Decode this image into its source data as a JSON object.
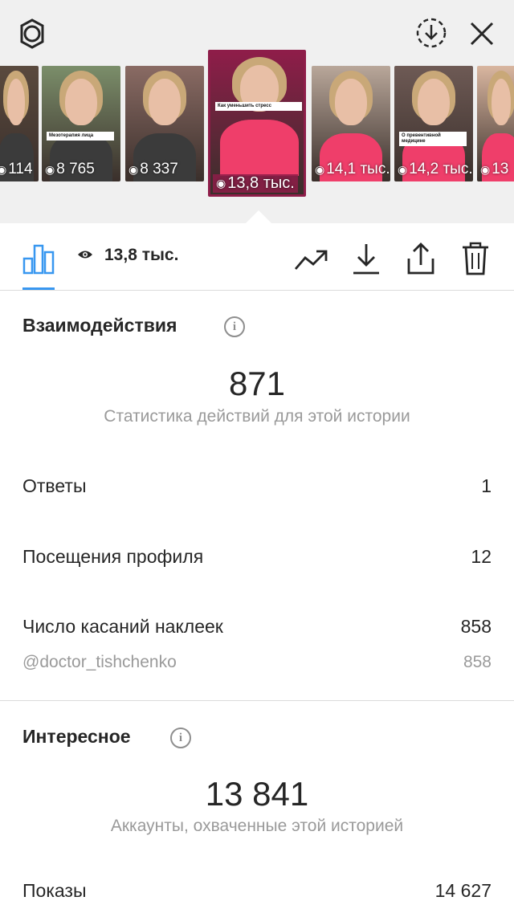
{
  "header": {
    "settings_icon": "gear-icon",
    "download_icon": "download-circle-icon",
    "close_icon": "close-icon"
  },
  "stories": [
    {
      "views": "114",
      "sticker": "",
      "bg": "#5a4a3e",
      "active": false
    },
    {
      "views": "8 765",
      "sticker": "Мезотерапия лица",
      "bg": "#7b8e6a",
      "active": false
    },
    {
      "views": "8 337",
      "sticker": "",
      "bg": "#8a6b64",
      "active": false
    },
    {
      "views": "13,8 тыс.",
      "sticker": "Как уменьшить стресс",
      "bg": "#8e1d49",
      "active": true
    },
    {
      "views": "14,1 тыс.",
      "sticker": "",
      "bg": "#b9a79a",
      "active": false
    },
    {
      "views": "14,2 тыс.",
      "sticker": "О превентивной медицине",
      "bg": "#6e5a55",
      "active": false
    },
    {
      "views": "13",
      "sticker": "",
      "bg": "#d9b6a0",
      "active": false
    }
  ],
  "toolbar": {
    "insights_tab_icon": "bar-chart-icon",
    "views_icon": "eye-icon",
    "views_label": "13,8 тыс.",
    "promote_icon": "trending-up-icon",
    "save_icon": "download-icon",
    "share_icon": "share-icon",
    "delete_icon": "trash-icon",
    "accent_color": "#3897f0"
  },
  "interactions": {
    "title": "Взаимодействия",
    "total": "871",
    "caption": "Статистика действий для этой истории",
    "rows": [
      {
        "label": "Ответы",
        "value": "1"
      },
      {
        "label": "Посещения профиля",
        "value": "12"
      },
      {
        "label": "Число касаний наклеек",
        "value": "858"
      }
    ],
    "sub_row": {
      "label": "@doctor_tishchenko",
      "value": "858"
    }
  },
  "discovery": {
    "title": "Интересное",
    "total": "13 841",
    "caption": "Аккаунты, охваченные этой историей",
    "rows": [
      {
        "label": "Показы",
        "value": "14 627"
      }
    ]
  }
}
